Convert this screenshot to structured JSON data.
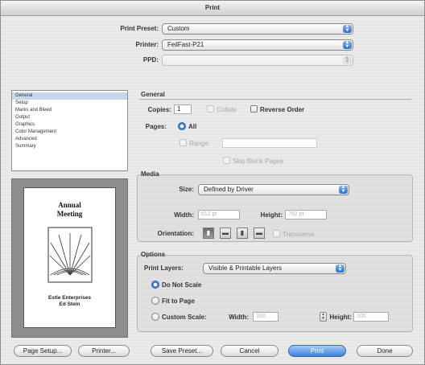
{
  "window": {
    "title": "Print"
  },
  "top": {
    "preset_label": "Print Preset:",
    "preset_value": "Custom",
    "printer_label": "Printer:",
    "printer_value": "FeilFast-P21",
    "ppd_label": "PPD:",
    "ppd_value": ""
  },
  "sidebar": {
    "items": [
      {
        "label": "General",
        "selected": true
      },
      {
        "label": "Setup",
        "selected": false
      },
      {
        "label": "Marks and Bleed",
        "selected": false
      },
      {
        "label": "Output",
        "selected": false
      },
      {
        "label": "Graphics",
        "selected": false
      },
      {
        "label": "Color Management",
        "selected": false
      },
      {
        "label": "Advanced",
        "selected": false
      },
      {
        "label": "Summary",
        "selected": false
      }
    ]
  },
  "preview": {
    "title_line1": "Annual",
    "title_line2": "Meeting",
    "company_line1": "Estle Enterprises",
    "company_line2": "Ed Stein"
  },
  "general": {
    "heading": "General",
    "copies_label": "Copies:",
    "copies_value": "1",
    "collate_label": "Collate",
    "reverse_label": "Reverse Order",
    "pages_label": "Pages:",
    "all_label": "All",
    "range_label": "Range:",
    "range_value": "",
    "skip_blank_label": "Skip Blank Pages"
  },
  "media": {
    "heading": "Media",
    "size_label": "Size:",
    "size_value": "Defined by Driver",
    "width_label": "Width:",
    "width_value": "612 pt",
    "height_label": "Height:",
    "height_value": "792 pt",
    "orientation_label": "Orientation:",
    "transverse_label": "Transverse"
  },
  "options": {
    "heading": "Options",
    "layers_label": "Print Layers:",
    "layers_value": "Visible & Printable Layers",
    "do_not_scale_label": "Do Not Scale",
    "fit_to_page_label": "Fit to Page",
    "custom_scale_label": "Custom Scale:",
    "width_label": "Width:",
    "width_value": "100",
    "height_label": "Height:",
    "height_value": "100"
  },
  "buttons": {
    "page_setup": "Page Setup...",
    "printer": "Printer...",
    "save_preset": "Save Preset...",
    "cancel": "Cancel",
    "print": "Print",
    "done": "Done"
  },
  "colors": {
    "accent": "#3a7fda",
    "selection": "#c7d7ee"
  }
}
